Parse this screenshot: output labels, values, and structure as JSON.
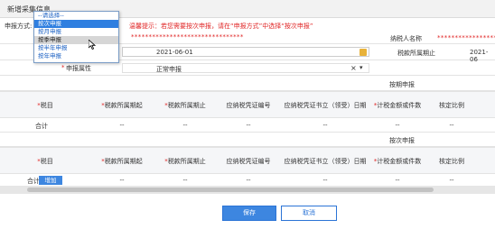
{
  "header": {
    "title": "新增采集信息"
  },
  "form": {
    "mode_label": "申报方式:",
    "hint": "温馨提示：若您需要按次申报，请在“申报方式”中选择“按次申报”",
    "dropdown_options": [
      "--请选择--",
      "按次申报",
      "按月申报",
      "按季申报",
      "按半年申报",
      "按年申报"
    ],
    "masked_value_1": "********************************",
    "date_value": "2021-06-01",
    "taxpayer_label": "纳税人名称",
    "taxpayer_value": "**********************",
    "period_end_label": "税款所属期止",
    "period_end_value": "2021-06",
    "declare_attr_label": "申报属性",
    "declare_attr_value": "正常申报",
    "clear_icon": "×",
    "arrow_icon": "▾"
  },
  "section1": {
    "title": "按期申报",
    "columns": [
      "税目",
      "税款所属期起",
      "税款所属期止",
      "应纳税凭证编号",
      "应纳税凭证书立（领受）日期",
      "计税金额或件数",
      "核定比例"
    ],
    "total_label": "合计",
    "dash": "--"
  },
  "section2": {
    "title": "按次申报",
    "columns": [
      "税目",
      "税款所属期起",
      "税款所属期止",
      "应纳税凭证编号",
      "应纳税凭证书立（领受）日期",
      "计税金额或件数",
      "核定比例"
    ],
    "total_label": "合计",
    "add_label": "增加",
    "dash": "--"
  },
  "buttons": {
    "save": "保存",
    "cancel": "取消"
  }
}
